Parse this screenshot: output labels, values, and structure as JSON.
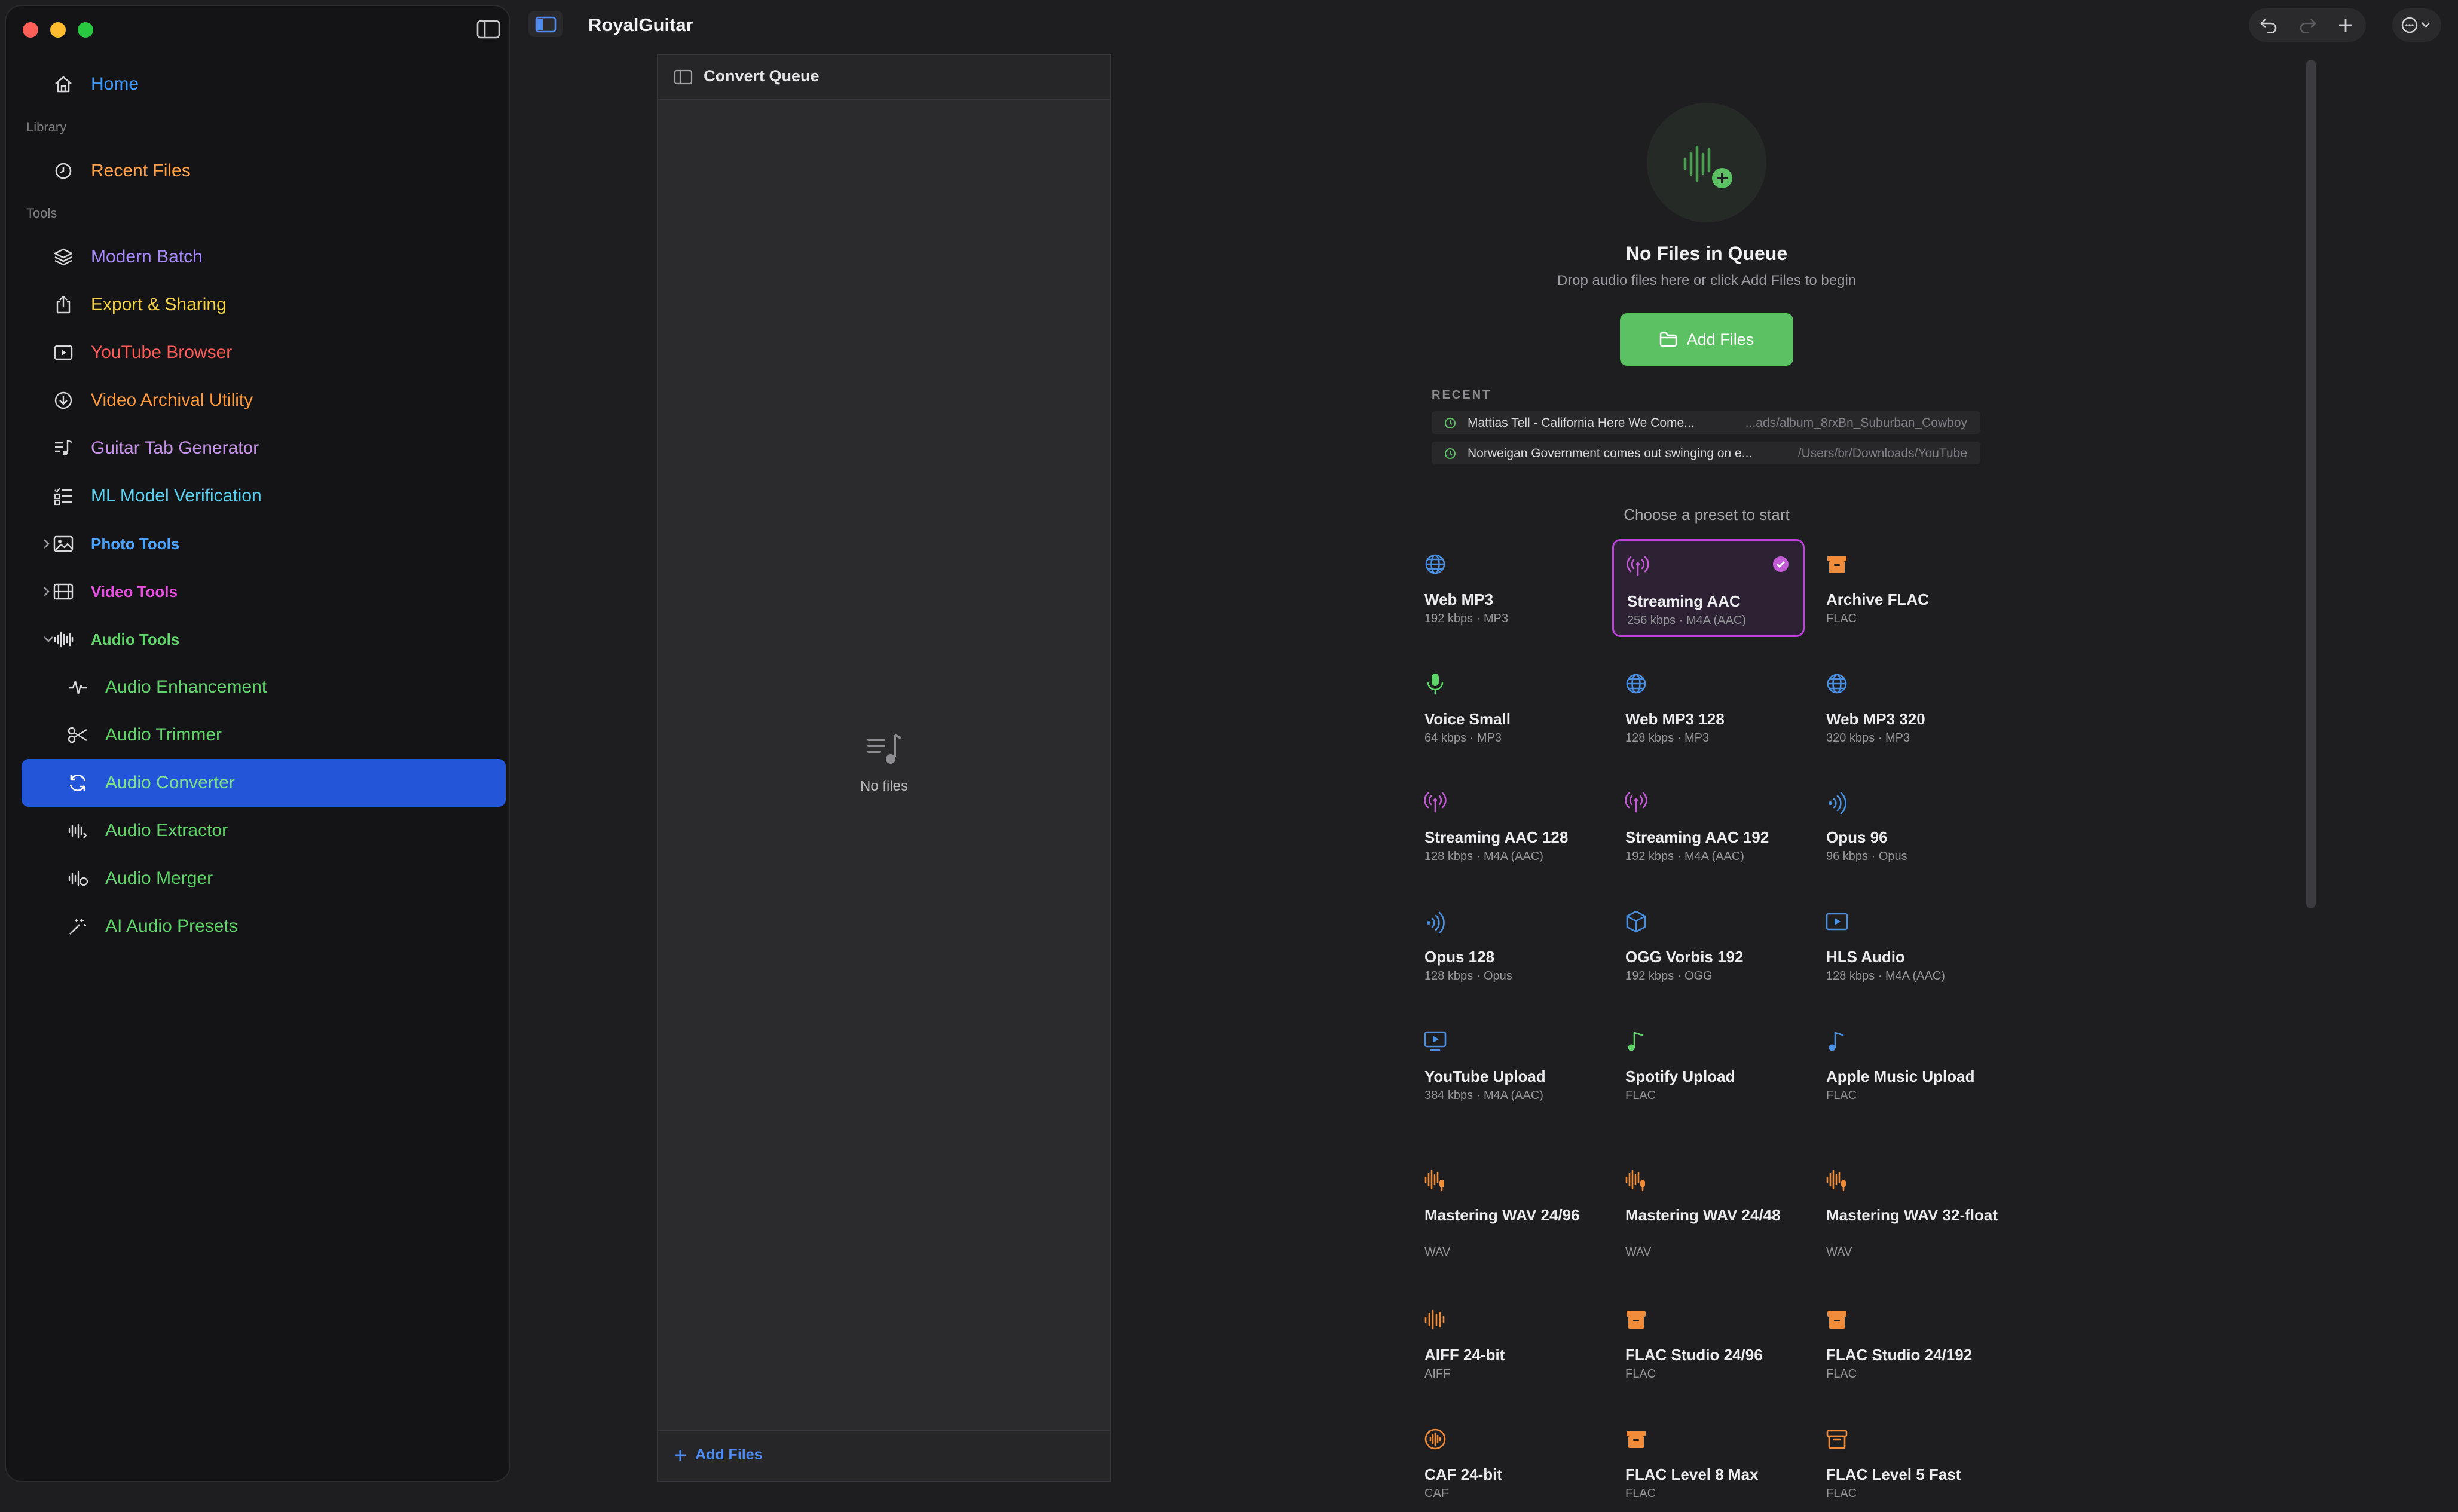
{
  "app": {
    "title": "RoyalGuitar"
  },
  "sidebar": {
    "home": "Home",
    "sections": {
      "library": "Library",
      "tools": "Tools"
    },
    "recent_files": "Recent Files",
    "tools": [
      {
        "label": "Modern Batch",
        "color": "#a78bfa"
      },
      {
        "label": "Export & Sharing",
        "color": "#f5d547"
      },
      {
        "label": "YouTube Browser",
        "color": "#ff5b5b"
      },
      {
        "label": "Video Archival Utility",
        "color": "#ff9a3c"
      },
      {
        "label": "Guitar Tab Generator",
        "color": "#c792ea"
      },
      {
        "label": "ML Model Verification",
        "color": "#5ad1f0"
      }
    ],
    "groups": [
      {
        "label": "Photo Tools",
        "color": "#4aa3ff"
      },
      {
        "label": "Video Tools",
        "color": "#e84ee0"
      },
      {
        "label": "Audio Tools",
        "color": "#5fd56a"
      }
    ],
    "audio_items": [
      {
        "label": "Audio Enhancement"
      },
      {
        "label": "Audio Trimmer"
      },
      {
        "label": "Audio Converter"
      },
      {
        "label": "Audio Extractor"
      },
      {
        "label": "Audio Merger"
      },
      {
        "label": "AI Audio Presets"
      }
    ]
  },
  "queue": {
    "title": "Convert Queue",
    "empty": "No files",
    "add_files": "Add Files"
  },
  "main": {
    "empty_title": "No Files in Queue",
    "empty_subtitle": "Drop audio files here or click Add Files to begin",
    "add_files": "Add Files",
    "recent_heading": "RECENT",
    "recent": [
      {
        "title": "Mattias Tell - California Here We Come...",
        "path": "...ads/album_8rxBn_Suburban_Cowboy"
      },
      {
        "title": "Norweigan Government comes out swinging on e...",
        "path": "/Users/br/Downloads/YouTube"
      }
    ],
    "choose_preset": "Choose a preset to start",
    "presets": [
      {
        "name": "Web MP3",
        "detail": "192 kbps · MP3",
        "icon": "globe-icon",
        "color": "#4a90e2"
      },
      {
        "name": "Streaming AAC",
        "detail": "256 kbps · M4A (AAC)",
        "icon": "broadcast-icon",
        "color": "#c35ad6",
        "selected": true
      },
      {
        "name": "Archive FLAC",
        "detail": "FLAC",
        "icon": "archive-box-icon",
        "color": "#f08c3a"
      },
      {
        "name": "Voice Small",
        "detail": "64 kbps · MP3",
        "icon": "microphone-icon",
        "color": "#5fd56a"
      },
      {
        "name": "Web MP3 128",
        "detail": "128 kbps · MP3",
        "icon": "globe-icon",
        "color": "#4a90e2"
      },
      {
        "name": "Web MP3 320",
        "detail": "320 kbps · MP3",
        "icon": "globe-icon",
        "color": "#4a90e2"
      },
      {
        "name": "Streaming AAC 128",
        "detail": "128 kbps · M4A (AAC)",
        "icon": "broadcast-icon",
        "color": "#c35ad6"
      },
      {
        "name": "Streaming AAC 192",
        "detail": "192 kbps · M4A (AAC)",
        "icon": "broadcast-icon",
        "color": "#c35ad6"
      },
      {
        "name": "Opus 96",
        "detail": "96 kbps · Opus",
        "icon": "sound-waves-icon",
        "color": "#4a90e2"
      },
      {
        "name": "Opus 128",
        "detail": "128 kbps · Opus",
        "icon": "sound-waves-icon",
        "color": "#4a90e2"
      },
      {
        "name": "OGG Vorbis 192",
        "detail": "192 kbps · OGG",
        "icon": "cube-icon",
        "color": "#4a90e2"
      },
      {
        "name": "HLS Audio",
        "detail": "128 kbps · M4A (AAC)",
        "icon": "play-rectangle-icon",
        "color": "#4a90e2"
      },
      {
        "name": "YouTube Upload",
        "detail": "384 kbps · M4A (AAC)",
        "icon": "play-tv-icon",
        "color": "#4a90e2"
      },
      {
        "name": "Spotify Upload",
        "detail": "FLAC",
        "icon": "music-note-icon",
        "color": "#5fd56a"
      },
      {
        "name": "Apple Music Upload",
        "detail": "FLAC",
        "icon": "music-note-icon",
        "color": "#4a90e2"
      },
      {
        "name": "Mastering WAV 24/96",
        "detail": "WAV",
        "icon": "waveform-mic-icon",
        "color": "#f08c3a"
      },
      {
        "name": "Mastering WAV 24/48",
        "detail": "WAV",
        "icon": "waveform-mic-icon",
        "color": "#f08c3a"
      },
      {
        "name": "Mastering WAV 32-float",
        "detail": "WAV",
        "icon": "waveform-mic-icon",
        "color": "#f08c3a"
      },
      {
        "name": "AIFF 24-bit",
        "detail": "AIFF",
        "icon": "waveform-icon",
        "color": "#f08c3a"
      },
      {
        "name": "FLAC Studio 24/96",
        "detail": "FLAC",
        "icon": "archive-box-icon",
        "color": "#f08c3a"
      },
      {
        "name": "FLAC Studio 24/192",
        "detail": "FLAC",
        "icon": "archive-box-icon",
        "color": "#f08c3a"
      },
      {
        "name": "CAF 24-bit",
        "detail": "CAF",
        "icon": "waveform-circle-icon",
        "color": "#f08c3a"
      },
      {
        "name": "FLAC Level 8 Max",
        "detail": "FLAC",
        "icon": "archive-box-icon",
        "color": "#f08c3a"
      },
      {
        "name": "FLAC Level 5 Fast",
        "detail": "FLAC",
        "icon": "archive-box-outline-icon",
        "color": "#f08c3a"
      }
    ]
  }
}
